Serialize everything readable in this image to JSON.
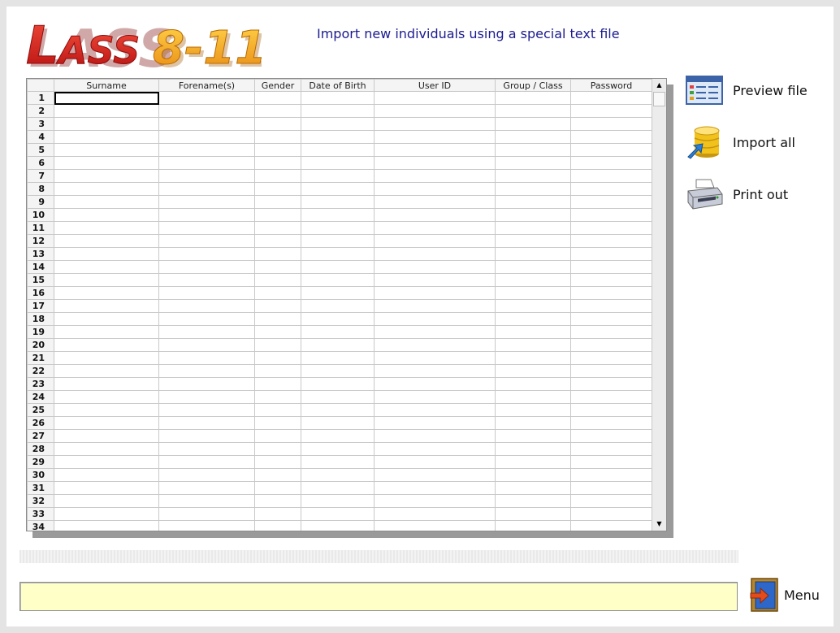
{
  "app": {
    "logo_text": "LASS8-11",
    "subtitle": "Import new individuals using a special text file"
  },
  "grid": {
    "columns": [
      "Surname",
      "Forename(s)",
      "Gender",
      "Date of Birth",
      "User ID",
      "Group / Class",
      "Password"
    ],
    "rows": [
      "1",
      "2",
      "3",
      "4",
      "5",
      "6",
      "7",
      "8",
      "9",
      "10",
      "11",
      "12",
      "13",
      "14",
      "15",
      "16",
      "17",
      "18",
      "19",
      "20",
      "21",
      "22",
      "23",
      "24",
      "25",
      "26",
      "27",
      "28",
      "29",
      "30",
      "31",
      "32",
      "33",
      "34"
    ],
    "active_cell": "1:Surname"
  },
  "actions": {
    "preview": {
      "label": "Preview file",
      "icon": "list-window-icon"
    },
    "import": {
      "label": "Import all",
      "icon": "database-import-icon"
    },
    "print": {
      "label": "Print out",
      "icon": "printer-icon"
    }
  },
  "status": {
    "message": ""
  },
  "menu": {
    "label": "Menu",
    "icon": "exit-door-icon"
  },
  "colors": {
    "subtitle": "#1b1b8f",
    "status_bg": "#ffffc8",
    "logo_red": "#d21f1f",
    "logo_orange": "#f2a51e"
  }
}
